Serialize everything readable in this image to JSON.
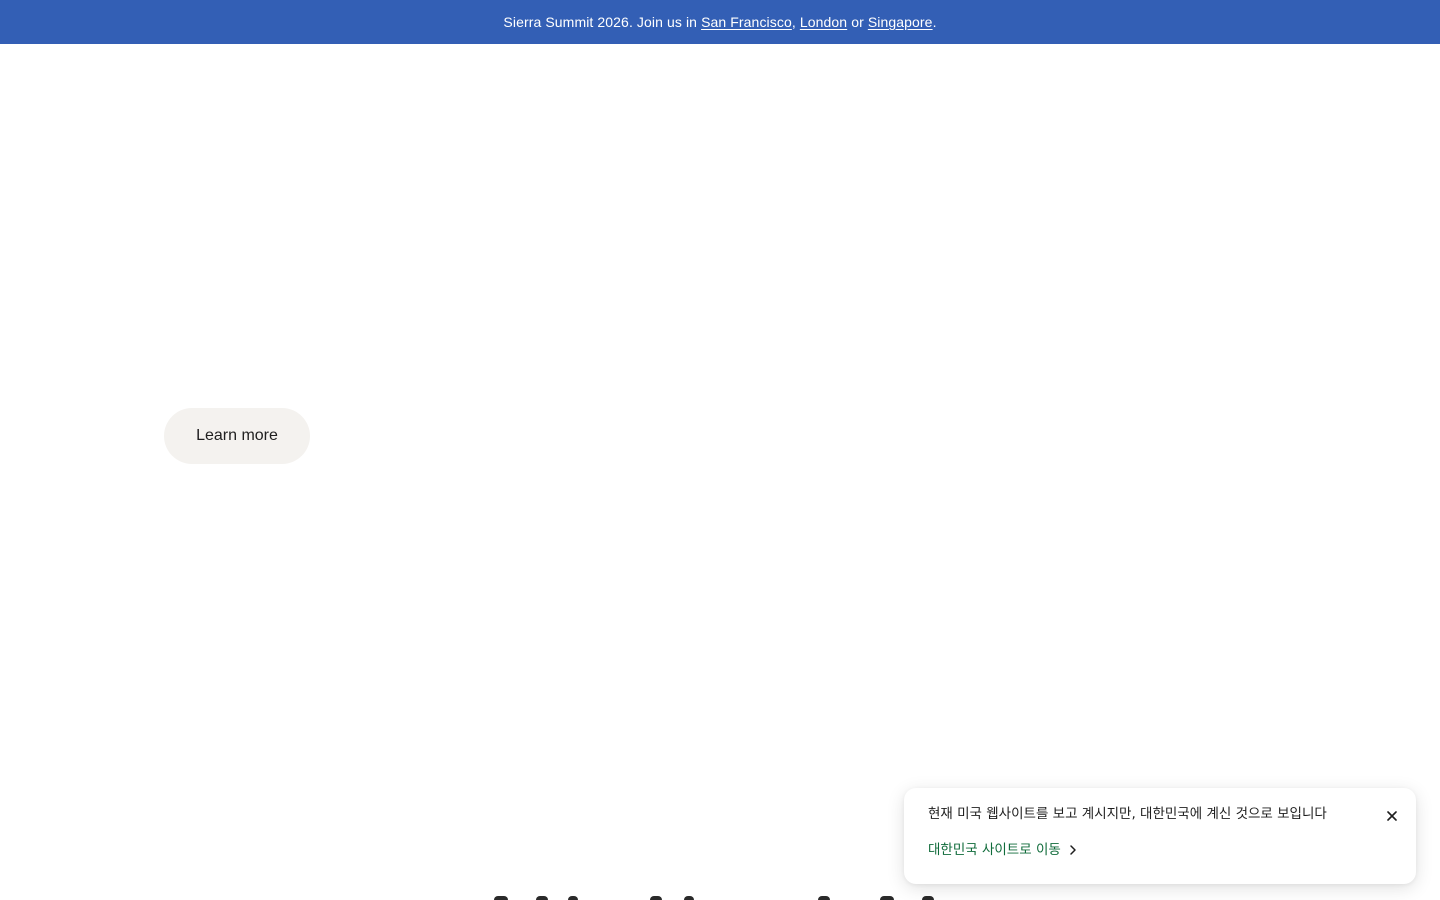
{
  "banner": {
    "prefix": "Sierra Summit 2026. Join us in",
    "links": [
      "San Francisco",
      "London",
      "Singapore"
    ],
    "comma": ",",
    "or": "or",
    "suffix": "."
  },
  "hero": {
    "learn_more_label": "Learn more"
  },
  "geo_toast": {
    "message": "현재 미국 웹사이트를 보고 계시지만, 대한민국에 계신 것으로 보입니다",
    "action_label": "대한민국 사이트로 이동",
    "action_icon": "chevron-right-icon",
    "close_icon": "close-icon",
    "action_color": "#0f6b3a"
  },
  "colors": {
    "banner_bg": "#335fb5",
    "button_bg": "#f4f2ef"
  }
}
